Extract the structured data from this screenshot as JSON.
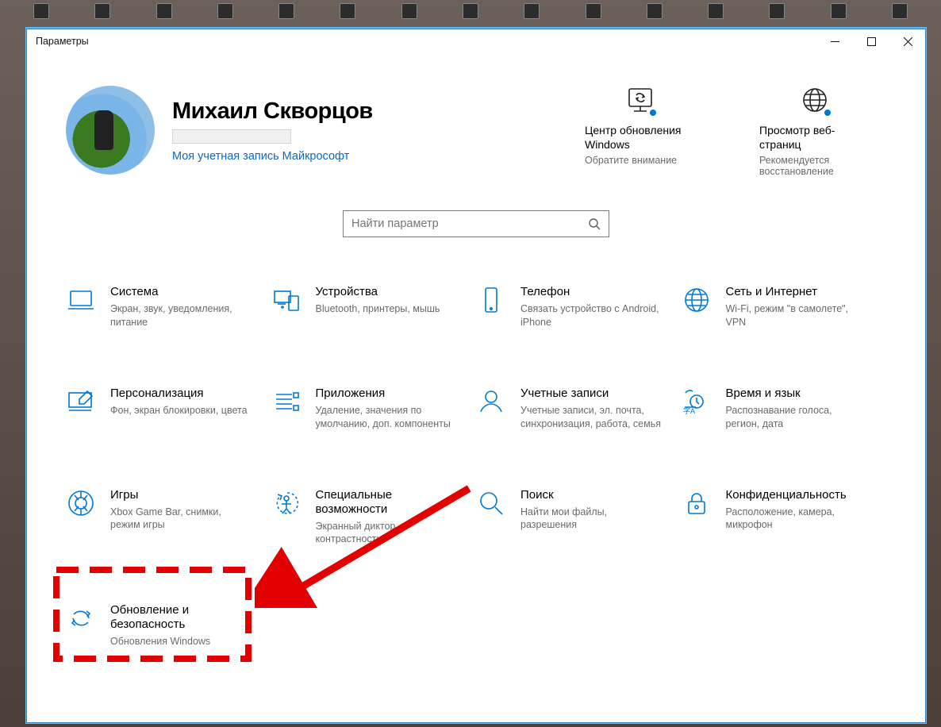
{
  "window": {
    "title": "Параметры"
  },
  "profile": {
    "name": "Михаил Скворцов",
    "link": "Моя учетная запись Майкрософт"
  },
  "quick": [
    {
      "icon": "sync-monitor-icon",
      "title": "Центр обновления Windows",
      "sub": "Обратите внимание"
    },
    {
      "icon": "globe-icon",
      "title": "Просмотр веб-страниц",
      "sub": "Рекомендуется восстановление"
    }
  ],
  "search": {
    "placeholder": "Найти параметр"
  },
  "tiles": [
    {
      "icon": "laptop-icon",
      "title": "Система",
      "sub": "Экран, звук, уведомления, питание"
    },
    {
      "icon": "devices-icon",
      "title": "Устройства",
      "sub": "Bluetooth, принтеры, мышь"
    },
    {
      "icon": "phone-icon",
      "title": "Телефон",
      "sub": "Связать устройство с Android, iPhone"
    },
    {
      "icon": "network-icon",
      "title": "Сеть и Интернет",
      "sub": "Wi-Fi, режим \"в самолете\", VPN"
    },
    {
      "icon": "personalize-icon",
      "title": "Персонализация",
      "sub": "Фон, экран блокировки, цвета"
    },
    {
      "icon": "apps-icon",
      "title": "Приложения",
      "sub": "Удаление, значения по умолчанию, доп. компоненты"
    },
    {
      "icon": "accounts-icon",
      "title": "Учетные записи",
      "sub": "Учетные записи, эл. почта, синхронизация, работа, семья"
    },
    {
      "icon": "time-lang-icon",
      "title": "Время и язык",
      "sub": "Распознавание голоса, регион, дата"
    },
    {
      "icon": "gaming-icon",
      "title": "Игры",
      "sub": "Xbox Game Bar, снимки, режим игры"
    },
    {
      "icon": "ease-icon",
      "title": "Специальные возможности",
      "sub": "Экранный диктор, контрастность"
    },
    {
      "icon": "search-tile-icon",
      "title": "Поиск",
      "sub": "Найти мои файлы, разрешения"
    },
    {
      "icon": "privacy-icon",
      "title": "Конфиденциальность",
      "sub": "Расположение, камера, микрофон"
    },
    {
      "icon": "update-icon",
      "title": "Обновление и безопасность",
      "sub": "Обновления Windows"
    }
  ],
  "annotation": {
    "highlighted_tile_index": 12
  }
}
